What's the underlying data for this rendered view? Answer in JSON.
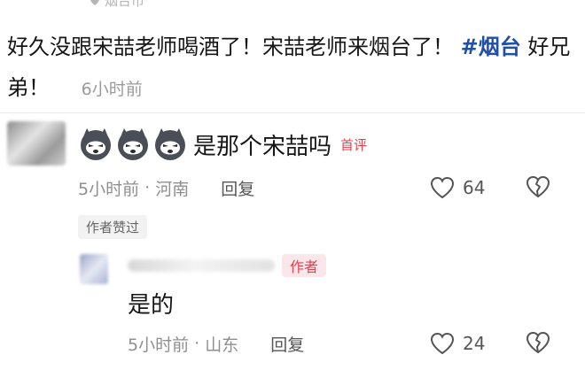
{
  "post": {
    "location": "烟台市",
    "text": "好久没跟宋喆老师喝酒了！宋喆老师来烟台了！",
    "hashtag": "#烟台",
    "text_tail": "好兄弟！",
    "time": "6小时前"
  },
  "comments": [
    {
      "text": "是那个宋喆吗",
      "badge": "首评",
      "time": "5小时前",
      "region": "河南",
      "reply_label": "回复",
      "likes": "64",
      "author_liked": "作者赞过"
    }
  ],
  "replies": [
    {
      "badge": "作者",
      "text": "是的",
      "time": "5小时前",
      "region": "山东",
      "reply_label": "回复",
      "likes": "24"
    }
  ],
  "colors": {
    "hashtag": "#1f4fa8",
    "badge": "#e2414f",
    "meta": "#8f8f8f"
  }
}
